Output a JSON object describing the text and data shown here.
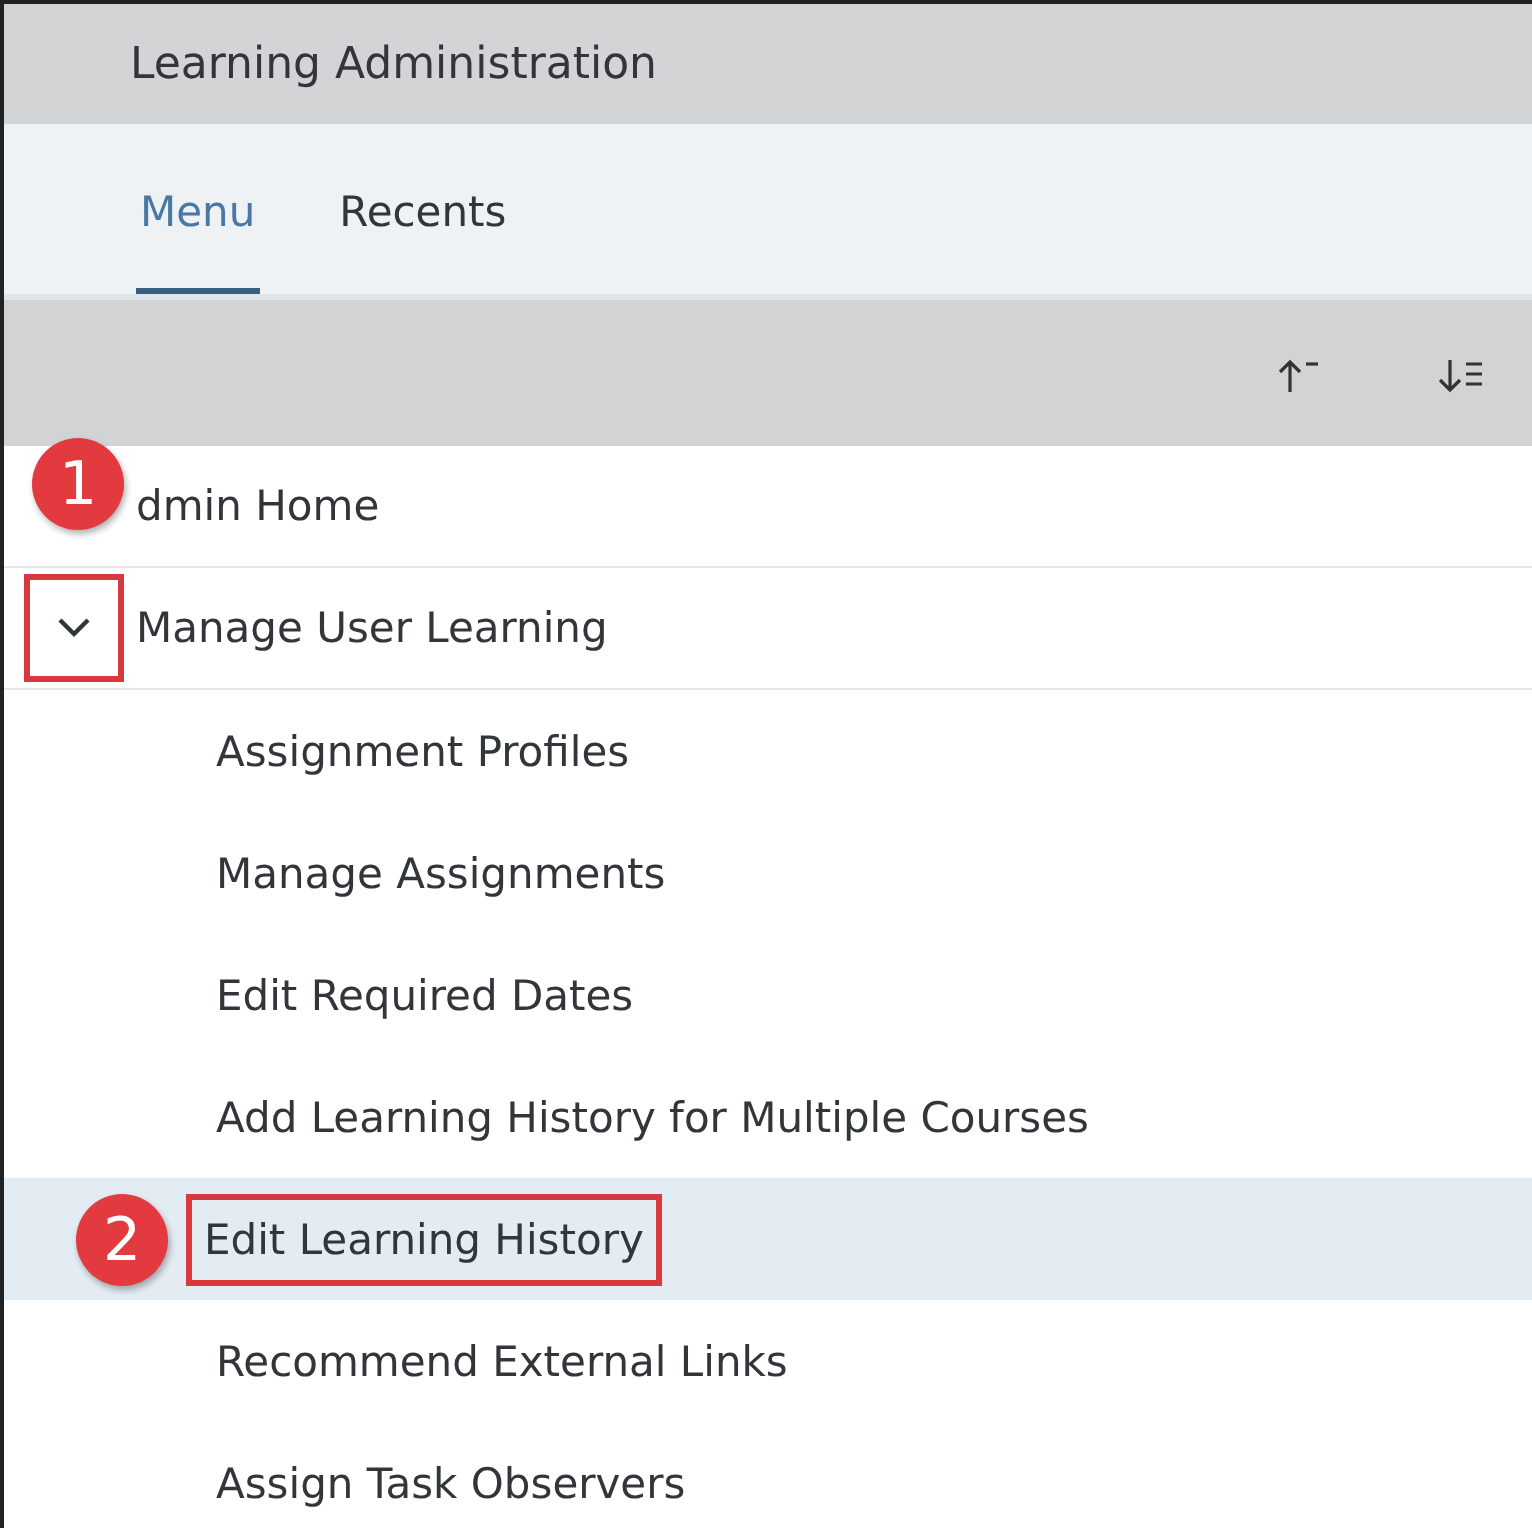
{
  "header": {
    "title": "Learning Administration"
  },
  "tabs": [
    {
      "label": "Menu",
      "selected": true
    },
    {
      "label": "Recents",
      "selected": false
    }
  ],
  "toolbar": {
    "buttons": [
      {
        "kind": "sort-ascending"
      },
      {
        "kind": "sort-descending"
      }
    ]
  },
  "menu": {
    "items": [
      {
        "label": "dmin Home",
        "callout": "1"
      },
      {
        "label": "Manage User Learning",
        "expanded": true,
        "toggle_highlighted": true,
        "children": [
          {
            "label": "Assignment Profiles",
            "selected": false
          },
          {
            "label": "Manage Assignments",
            "selected": false
          },
          {
            "label": "Edit Required Dates",
            "selected": false
          },
          {
            "label": "Add Learning History for Multiple Courses",
            "selected": false
          },
          {
            "label": "Edit Learning History",
            "selected": true,
            "callout": "2",
            "label_highlighted": true
          },
          {
            "label": "Recommend External Links",
            "selected": false
          },
          {
            "label": "Assign Task Observers",
            "selected": false
          }
        ]
      }
    ]
  }
}
